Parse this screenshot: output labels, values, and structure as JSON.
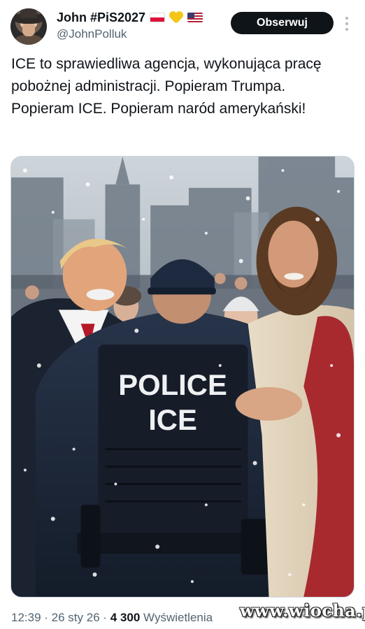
{
  "header": {
    "display_name": "John #PiS2027",
    "handle": "@JohnPolluk",
    "follow_label": "Obserwuj",
    "badges": [
      "poland-flag-icon",
      "yellow-heart-icon",
      "us-flag-icon"
    ]
  },
  "tweet": {
    "text": "ICE to sprawiedliwa agencja, wykonująca pracę pobożnej administracji. Popieram Trumpa. Popieram ICE. Popieram naród amerykański!"
  },
  "media": {
    "vest_line1": "POLICE",
    "vest_line2": "ICE"
  },
  "footer": {
    "time": "12:39",
    "separator": " · ",
    "date": "26 sty 26",
    "views_count": "4 300",
    "views_label": "Wyświetlenia"
  },
  "watermark": "www.wiocha.pl",
  "colors": {
    "follow_button": "#0f1419",
    "secondary_text": "#536471",
    "primary_text": "#0f1419"
  }
}
